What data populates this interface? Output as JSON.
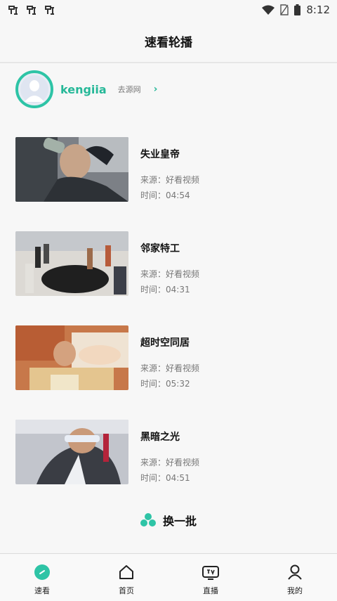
{
  "status_bar": {
    "time": "8:12",
    "left_icons": [
      "bug-icon",
      "bug-icon",
      "bug-icon"
    ],
    "right_icons": [
      "wifi-icon",
      "no-sim-icon",
      "battery-icon"
    ]
  },
  "header": {
    "title": "速看轮播"
  },
  "profile": {
    "name": "kengiia",
    "link_label": "去源网",
    "arrow": "›"
  },
  "videos": [
    {
      "title": "失业皇帝",
      "source": "来源：好看视频",
      "time": "时间：04:54",
      "thumb_colors": [
        "#4a4f55",
        "#8c8f93",
        "#c9c2b6"
      ]
    },
    {
      "title": "邻家特工",
      "source": "来源：好看视频",
      "time": "时间：04:31",
      "thumb_colors": [
        "#d9d6d2",
        "#2b2b2b",
        "#9aa0a8"
      ]
    },
    {
      "title": "超时空同居",
      "source": "来源：好看视频",
      "time": "时间：05:32",
      "thumb_colors": [
        "#b8643a",
        "#e6c9a8",
        "#6e4a3a"
      ]
    },
    {
      "title": "黑暗之光",
      "source": "来源：好看视频",
      "time": "时间：04:51",
      "thumb_colors": [
        "#b9bcc4",
        "#3d4047",
        "#dcdfe5"
      ]
    }
  ],
  "refresh": {
    "label": "换一批",
    "color": "#2ec4a6"
  },
  "tabs": [
    {
      "label": "速看",
      "icon": "play-circle-icon",
      "active": true
    },
    {
      "label": "首页",
      "icon": "home-icon",
      "active": false
    },
    {
      "label": "直播",
      "icon": "tv-icon",
      "active": false
    },
    {
      "label": "我的",
      "icon": "user-icon",
      "active": false
    }
  ],
  "accent": "#2ec4a6"
}
